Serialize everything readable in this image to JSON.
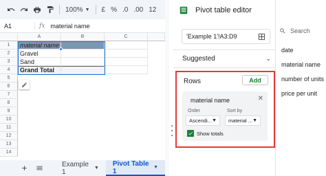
{
  "toolbar": {
    "zoom": "100%",
    "currency": "£",
    "percent": "%",
    "decimal_dec": ".0",
    "decimal_inc": ".00",
    "font_size": "12"
  },
  "formula_bar": {
    "cell_ref": "A1",
    "fx": "fx",
    "value": "material name"
  },
  "grid": {
    "columns": [
      "A",
      "B",
      "C"
    ],
    "rows": [
      "1",
      "2",
      "3",
      "4",
      "5",
      "6",
      "7",
      "8",
      "9",
      "10",
      "11",
      "12",
      "13",
      "14"
    ],
    "cells": {
      "a1": "material name",
      "a2": "Gravel",
      "a3": "Sand",
      "a4": "Grand Total"
    }
  },
  "sheet_tabs": {
    "tabs": [
      {
        "label": "Example 1"
      },
      {
        "label": "Pivot Table 1"
      }
    ]
  },
  "editor": {
    "title": "Pivot table editor",
    "range": "'Example 1'!A3:D9",
    "suggested": "Suggested",
    "rows": {
      "label": "Rows",
      "add": "Add",
      "field": "material name",
      "order_label": "Order",
      "order_value": "Ascendi...",
      "sortby_label": "Sort by",
      "sortby_value": "material ...",
      "show_totals": "Show totals"
    }
  },
  "field_list": {
    "search": "Search",
    "items": [
      "date",
      "material name",
      "number of units",
      "price per unit"
    ]
  },
  "colors": {
    "pivot_header": "#8094b4",
    "highlight": "#e53935",
    "accent_green": "#188038"
  }
}
